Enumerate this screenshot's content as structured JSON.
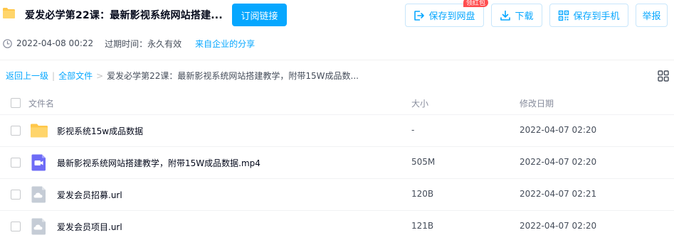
{
  "header": {
    "title": "爱发必学第22课：最新影视系统网站搭建...",
    "subscribe_label": "订阅链接",
    "save_cloud_label": "保存到网盘",
    "badge_label": "领红包",
    "download_label": "下载",
    "save_phone_label": "保存到手机",
    "report_label": "举报"
  },
  "meta": {
    "shared_time": "2022-04-08 00:22",
    "expire": "过期时间：永久有效",
    "source": "来自企业的分享"
  },
  "breadcrumb": {
    "back": "返回上一级",
    "sep": "|",
    "all_files": "全部文件",
    "arrow": ">",
    "current": "爱发必学第22课：最新影视系统网站搭建教学，附带15W成品数..."
  },
  "table": {
    "headers": {
      "name": "文件名",
      "size": "大小",
      "date": "修改日期"
    },
    "rows": [
      {
        "name": "影视系统15w成品数据",
        "size": "-",
        "date": "2022-04-07 02:20",
        "icon": "folder-icon"
      },
      {
        "name": "最新影视系统网站搭建教学，附带15W成品数据.mp4",
        "size": "505M",
        "date": "2022-04-07 02:20",
        "icon": "video-file-icon"
      },
      {
        "name": "爱发会员招募.url",
        "size": "120B",
        "date": "2022-04-07 02:21",
        "icon": "url-file-icon"
      },
      {
        "name": "爱发会员项目.url",
        "size": "121B",
        "date": "2022-04-07 02:20",
        "icon": "url-file-icon"
      }
    ]
  },
  "colors": {
    "accent": "#06a7ff",
    "folder": "#ffc74a",
    "video": "#6e6cf6",
    "badge": "#ff4d4f",
    "url_file": "#c5ccd6"
  }
}
